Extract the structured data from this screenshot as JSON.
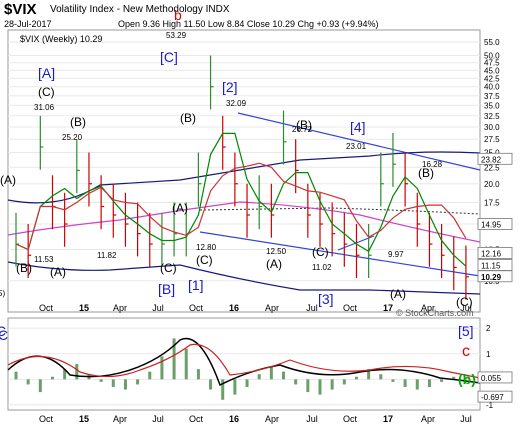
{
  "header": {
    "title": "$VIX",
    "subtitle": "Volatility Index - New Methodology  INDX",
    "date": "28-Jul-2017",
    "ohlc": "Open 9.36  High 11.50  Low 8.84  Close 10.29  Chg +0.93 (+9.94%)",
    "legend": "$VIX (Weekly) 10.29",
    "watermark": "© StockCharts.com"
  },
  "colors": {
    "price": "#cc0000",
    "up": "#2e8b2e",
    "ma_fast": "#008800",
    "ma_slow": "#cc3333",
    "band": "#cc44cc",
    "trendline": "#3344dd",
    "wave_label": "#1a1acc",
    "red_label": "#dd0000",
    "green_label": "#00aa00",
    "grid": "#e8e8e8"
  },
  "chart_data": [
    {
      "type": "line",
      "panel": "price",
      "ylim": [
        8,
        60
      ],
      "scale": "log",
      "y_ticks": [
        "55.0",
        "50.0",
        "47.5",
        "45.0",
        "42.5",
        "40.0",
        "37.5",
        "35.0",
        "32.5",
        "30.0",
        "27.5",
        "25.0",
        "22.5",
        "20.0",
        "17.5",
        "15.0",
        "12.5",
        "10.0"
      ],
      "x_ticks": [
        "Oct",
        "15",
        "Apr",
        "Jul",
        "Oct",
        "16",
        "Apr",
        "Jul",
        "Oct",
        "17",
        "Apr",
        "Jul"
      ],
      "price_labels": [
        "23.82",
        "14.95",
        "12.16",
        "11.15",
        "10.29"
      ],
      "series": [
        {
          "x": [
            0,
            4,
            8,
            12,
            16,
            20,
            24,
            28,
            32,
            36,
            40,
            44,
            48,
            52,
            56,
            60,
            64,
            68,
            72,
            76,
            80,
            84,
            88,
            92,
            96,
            100,
            104,
            108,
            112,
            116,
            120,
            124,
            128,
            132,
            136,
            140,
            144,
            148
          ],
          "values": [
            13,
            12,
            26,
            17,
            15,
            22,
            20,
            17,
            16,
            15,
            14,
            13,
            13,
            14,
            14,
            20,
            40,
            26,
            20,
            16,
            17,
            16,
            27,
            22,
            16,
            15,
            14,
            13,
            12,
            12,
            20,
            23,
            20,
            15,
            13,
            12,
            11,
            10.29
          ]
        }
      ],
      "annotations": [
        {
          "text": "[A]",
          "color": "wave"
        },
        {
          "text": "(C)",
          "color": "black"
        },
        {
          "text": "31.06",
          "color": "black"
        },
        {
          "text": "(B)",
          "color": "black"
        },
        {
          "text": "25.20",
          "color": "black"
        },
        {
          "text": "(A)",
          "color": "black"
        },
        {
          "text": "(B)",
          "color": "black"
        },
        {
          "text": "(A)",
          "color": "black"
        },
        {
          "text": "11.53",
          "color": "black"
        },
        {
          "text": "11.82",
          "color": "black"
        },
        {
          "text": "[C]",
          "color": "wave"
        },
        {
          "text": "b",
          "color": "red"
        },
        {
          "text": "53.29",
          "color": "black"
        },
        {
          "text": "(B)",
          "color": "black"
        },
        {
          "text": "(A)",
          "color": "black"
        },
        {
          "text": "12.80",
          "color": "black"
        },
        {
          "text": "(C)",
          "color": "black"
        },
        {
          "text": "(C)",
          "color": "black"
        },
        {
          "text": "[B]",
          "color": "wave"
        },
        {
          "text": "[1]",
          "color": "wave"
        },
        {
          "text": "[2]",
          "color": "wave"
        },
        {
          "text": "32.09",
          "color": "black"
        },
        {
          "text": "12.50",
          "color": "black"
        },
        {
          "text": "(A)",
          "color": "black"
        },
        {
          "text": "(B)",
          "color": "black"
        },
        {
          "text": "26.72",
          "color": "black"
        },
        {
          "text": "11.02",
          "color": "black"
        },
        {
          "text": "(C)",
          "color": "black"
        },
        {
          "text": "[3]",
          "color": "wave"
        },
        {
          "text": "[4]",
          "color": "wave"
        },
        {
          "text": "23.01",
          "color": "black"
        },
        {
          "text": "(B)",
          "color": "black"
        },
        {
          "text": "16.28",
          "color": "black"
        },
        {
          "text": "9.97",
          "color": "black"
        },
        {
          "text": "(A)",
          "color": "black"
        },
        {
          "text": "(C)",
          "color": "black"
        },
        {
          "text": "5)",
          "color": "black"
        },
        {
          "text": "C",
          "color": "wave"
        }
      ]
    },
    {
      "type": "bar",
      "panel": "oscillator",
      "ylim": [
        -1.2,
        2.4
      ],
      "y_ticks": [
        "2",
        "1",
        "0",
        "-1"
      ],
      "value_labels": [
        "0.055",
        "-0.697"
      ],
      "wave_labels": [
        {
          "text": "[5]",
          "color": "wave"
        },
        {
          "text": "c",
          "color": "red"
        },
        {
          "text": "(b)",
          "color": "green"
        },
        {
          "text": "C",
          "color": "wave"
        }
      ],
      "series": [
        {
          "name": "histogram",
          "values": [
            0.3,
            -0.2,
            -0.5,
            0.1,
            0.4,
            0.6,
            0.2,
            -0.1,
            -0.3,
            -0.4,
            -0.2,
            0.3,
            0.9,
            1.6,
            1.2,
            0.4,
            -0.4,
            -0.8,
            -0.6,
            -0.3,
            0.2,
            0.5,
            0.3,
            -0.2,
            -0.5,
            -0.6,
            -0.4,
            -0.2,
            0.1,
            0.4,
            0.2,
            -0.1,
            -0.3,
            -0.4,
            -0.3,
            -0.1,
            0.1,
            0.055
          ]
        }
      ]
    }
  ]
}
